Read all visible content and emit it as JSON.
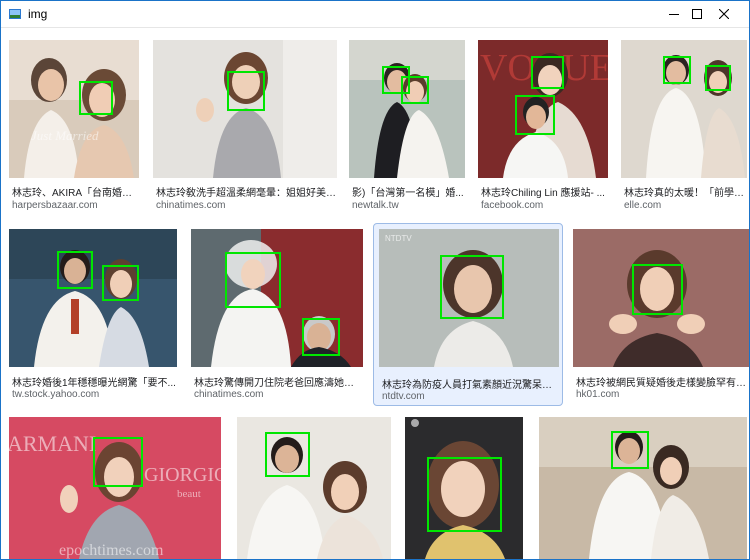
{
  "window": {
    "title": "img"
  },
  "colors": {
    "detection_box": "#00e600",
    "selected_tile_bg": "#e8f0fe",
    "title_accent": "#1a73c8"
  },
  "results": [
    {
      "caption": "林志玲、AKIRA「台南婚禮...",
      "source": "harpersbazaar.com"
    },
    {
      "caption": "林志玲敎洗手超溫柔網毫暈：姐姐好美- ...",
      "source": "chinatimes.com"
    },
    {
      "caption": "影)「台灣第一名模」婚...",
      "source": "newtalk.tw"
    },
    {
      "caption": "林志玲Chiling Lin 應援站- ...",
      "source": "facebook.com"
    },
    {
      "caption": "林志玲真的太暖！「前學生...",
      "source": "elle.com"
    },
    {
      "caption": "林志玲婚後1年穩穩曝光網驚「要不...",
      "source": "tw.stock.yahoo.com"
    },
    {
      "caption": "林志玲驚傳開刀住院老爸回應濤她堅...",
      "source": "chinatimes.com"
    },
    {
      "caption": "林志玲為防疫人員打氣素顏近況驚呆網...",
      "source": "ntdtv.com"
    },
    {
      "caption": "林志玲被網民質疑婚後走樣變臉罕有上...",
      "source": "hk01.com"
    },
    {
      "caption": "",
      "source": ""
    },
    {
      "caption": "",
      "source": ""
    },
    {
      "caption": "",
      "source": ""
    },
    {
      "caption": "",
      "source": ""
    }
  ],
  "watermarks": {
    "just_married": "Just Married",
    "vogue": "VOGUE",
    "armani": "ARMANI",
    "giorgio": "GIORGIO A",
    "beaute": "beaut",
    "epoch": "epochtimes.com",
    "ntdtv_logo": "NTDTV"
  }
}
